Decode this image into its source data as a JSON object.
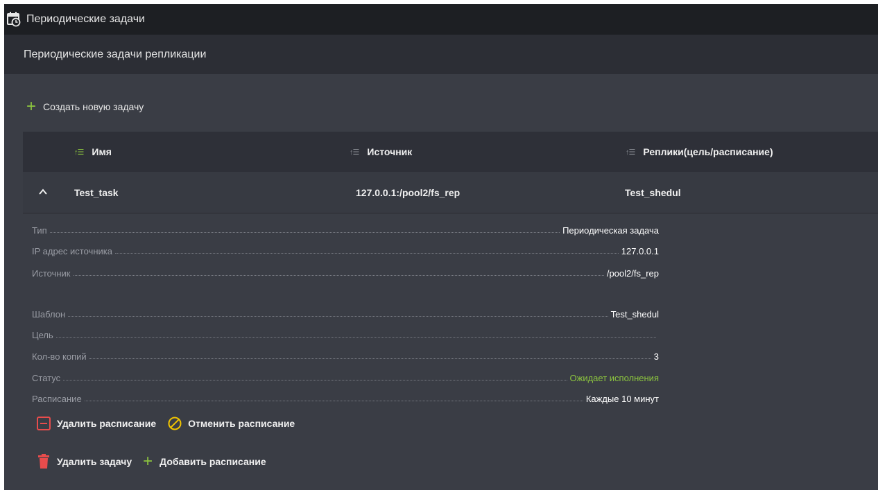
{
  "window": {
    "title": "Периодические задачи"
  },
  "section": {
    "title": "Периодические задачи репликации"
  },
  "toolbar": {
    "create_label": "Создать новую задачу"
  },
  "table": {
    "columns": [
      "Имя",
      "Источник",
      "Реплики(цель/расписание)"
    ],
    "row": {
      "name": "Test_task",
      "source": "127.0.0.1:/pool2/fs_rep",
      "replicas": "Test_shedul"
    }
  },
  "details": [
    {
      "key": "Тип",
      "value": "Периодическая задача"
    },
    {
      "key": "IP адрес источника",
      "value": "127.0.0.1"
    },
    {
      "key": "Источник",
      "value": "/pool2/fs_rep"
    },
    {
      "key": "Шаблон",
      "value": "Test_shedul"
    },
    {
      "key": "Цель",
      "value": ""
    },
    {
      "key": "Кол-во копий",
      "value": "3"
    },
    {
      "key": "Статус",
      "value": "Ожидает исполнения"
    },
    {
      "key": "Расписание",
      "value": "Каждые 10 минут"
    }
  ],
  "actions": {
    "delete_schedule": "Удалить расписание",
    "cancel_schedule": "Отменить расписание",
    "delete_task": "Удалить задачу",
    "add_schedule": "Добавить расписание"
  },
  "colors": {
    "accent_green": "#8dc63f",
    "danger_red": "#e84c4c",
    "warning_yellow": "#f2c500"
  },
  "icons": [
    "calendar-clock-icon",
    "plus-icon",
    "sort-icon",
    "chevron-up-icon",
    "minus-square-icon",
    "cancel-circle-icon",
    "trash-icon"
  ]
}
